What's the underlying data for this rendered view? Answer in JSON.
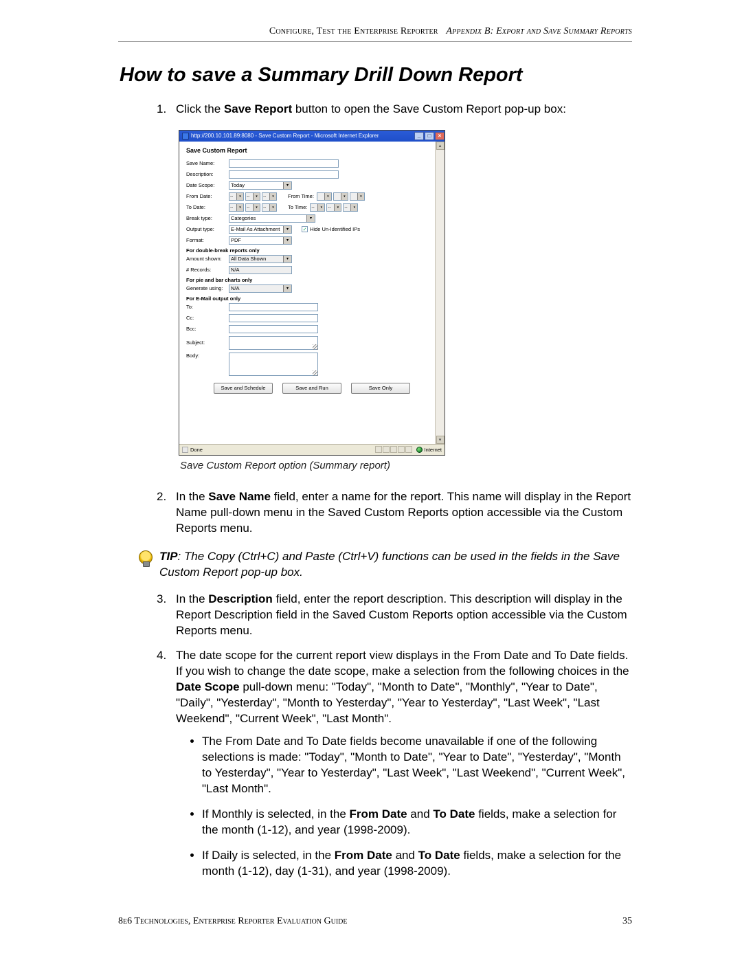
{
  "header": {
    "left": "Configure, Test the Enterprise Reporter",
    "right_italic": "Appendix B: Export and Save Summary Reports"
  },
  "title": "How to save a Summary Drill Down Report",
  "steps": {
    "s1": {
      "num": "1.",
      "pre": "Click the ",
      "bold": "Save Report",
      "post": " button to open the Save Custom Report pop-up box:"
    },
    "s2": {
      "num": "2.",
      "pre": "In the ",
      "bold": "Save Name",
      "post": " field, enter a name for the report. This name will display in the Report Name pull-down menu in the Saved Custom Reports option accessible via the Custom Reports menu."
    },
    "s3": {
      "num": "3.",
      "pre": "In the ",
      "bold": "Description",
      "post": " field, enter the report description. This description will display in the Report Description field in the Saved Custom Reports option accessible via the Custom Reports menu."
    },
    "s4": {
      "num": "4.",
      "pre": "The date scope for the current report view displays in the From Date and To Date fields. If you wish to change the date scope, make a selection from the following choices in the ",
      "bold": "Date Scope",
      "post": " pull-down menu: \"Today\", \"Month to Date\", \"Monthly\", \"Year to Date\", \"Daily\", \"Yesterday\", \"Month to Yesterday\", \"Year to Yesterday\", \"Last Week\", \"Last Weekend\", \"Current Week\", \"Last Month\"."
    }
  },
  "bullets": {
    "b1": "The From Date and To Date fields become unavailable if one of the following selections is made: \"Today\", \"Month to Date\", \"Year to Date\", \"Yesterday\", \"Month to Yesterday\", \"Year to Yesterday\", \"Last Week\", \"Last Weekend\", \"Current Week\", \"Last Month\".",
    "b2_pre": "If Monthly is selected, in the ",
    "b2_bold1": "From Date",
    "b2_mid": " and ",
    "b2_bold2": "To Date",
    "b2_post": " fields, make a selection for the month (1-12), and year (1998-2009).",
    "b3_pre": "If Daily is selected, in the ",
    "b3_bold1": "From Date",
    "b3_mid": " and ",
    "b3_bold2": "To Date",
    "b3_post": " fields, make a selection for the month (1-12), day (1-31), and year (1998-2009)."
  },
  "tip": {
    "label": "TIP",
    "text": ": The Copy (Ctrl+C) and Paste (Ctrl+V) functions can be used in the fields in the Save Custom Report pop-up box."
  },
  "screenshot": {
    "caption": "Save Custom Report option (Summary report)",
    "window_title": "http://200.10.101.89:8080 - Save Custom Report - Microsoft Internet Explorer",
    "header": "Save Custom Report",
    "labels": {
      "save_name": "Save Name:",
      "description": "Description:",
      "date_scope": "Date Scope:",
      "from_date": "From Date:",
      "to_date": "To Date:",
      "from_time": "From Time:",
      "to_time": "To Time:",
      "break_type": "Break type:",
      "output_type": "Output type:",
      "format": "Format:",
      "hide_ips": "Hide Un-Identified IPs",
      "sect_double": "For double-break reports only",
      "amount_shown": "Amount shown:",
      "num_records": "# Records:",
      "sect_pie": "For pie and bar charts only",
      "generate_using": "Generate using:",
      "sect_email": "For E-Mail output only",
      "to": "To:",
      "cc": "Cc:",
      "bcc": "Bcc:",
      "subject": "Subject:",
      "body": "Body:"
    },
    "values": {
      "date_scope": "Today",
      "break_type": "Categories",
      "output_type": "E-Mail As Attachment",
      "format": "PDF",
      "amount_shown": "All Data Shown",
      "num_records": "N/A",
      "generate_using": "N/A",
      "date_placeholder": "--"
    },
    "buttons": {
      "save_schedule": "Save and Schedule",
      "save_run": "Save and Run",
      "save_only": "Save Only"
    },
    "status": {
      "done": "Done",
      "zone": "Internet"
    }
  },
  "footer": {
    "left": "8e6 Technologies, Enterprise Reporter  Evaluation Guide",
    "right": "35"
  }
}
